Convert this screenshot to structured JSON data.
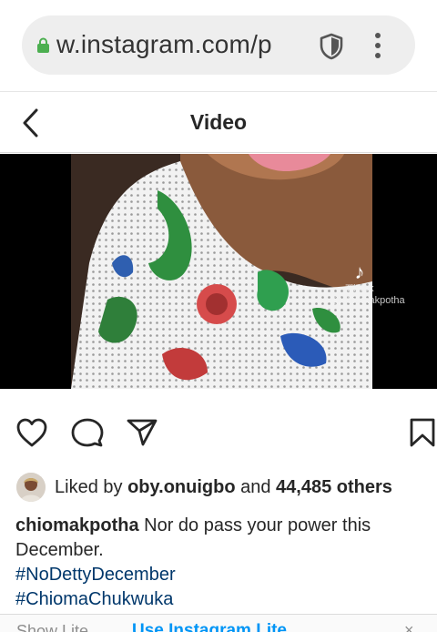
{
  "browser": {
    "url": "w.instagram.com/p",
    "lock_color": "#4caf50"
  },
  "header": {
    "title": "Video"
  },
  "video": {
    "watermark_brand": "TikTok",
    "watermark_handle": "@chiomakpotha"
  },
  "likes": {
    "prefix": "Liked by ",
    "user": "oby.onuigbo",
    "middle": " and ",
    "count": "44,485 others"
  },
  "caption": {
    "username": "chiomakpotha",
    "text": " Nor do pass your power this December.",
    "hashtags": [
      "#NoDettyDecember",
      "#ChiomaChukwuka"
    ]
  },
  "banner": {
    "left_text": "Show Lite",
    "link_text": "Use Instagram Lite",
    "close": "×"
  },
  "icons": {
    "lock": "lock-icon",
    "shield": "shield-icon",
    "menu": "kebab-menu-icon",
    "back": "back-arrow-icon",
    "like": "heart-icon",
    "comment": "comment-icon",
    "share": "send-icon",
    "save": "bookmark-icon"
  }
}
